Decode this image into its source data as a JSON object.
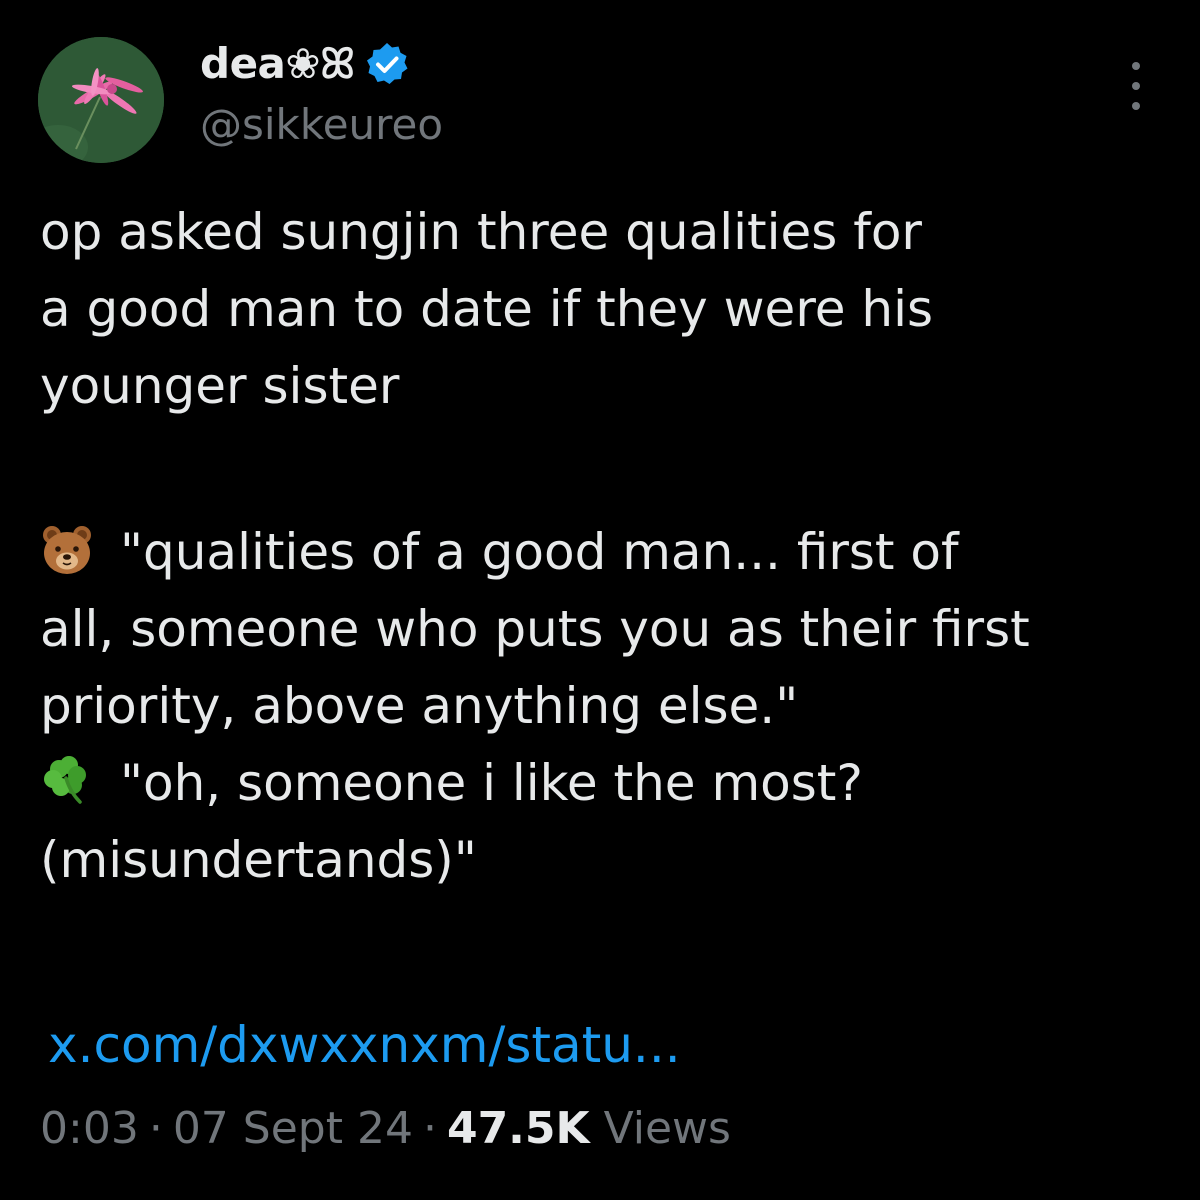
{
  "author": {
    "display_name": "dea❀ꕤ",
    "handle": "@sikkeureo",
    "verified": true,
    "avatar_icon": "pink-flower-avatar"
  },
  "menu": {
    "icon": "more-options-icon"
  },
  "tweet": {
    "lines_part1": [
      "op asked sungjin three qualities for",
      "a good man to date if they were his",
      "younger sister"
    ],
    "quote1": {
      "icon": "bear-face-emoji-icon",
      "lines": [
        "\"qualities of a good man... first of",
        "all, someone who puts you as their first",
        "priority, above anything else.\""
      ]
    },
    "quote2": {
      "icon": "four-leaf-clover-emoji-icon",
      "lines": [
        "\"oh, someone i like the most?",
        "(misundertands)\""
      ]
    },
    "link": "x.com/dxwxxnxm/statu..."
  },
  "meta": {
    "time": "0:03",
    "date": "07 Sept 24",
    "views_count": "47.5K",
    "views_label": "Views",
    "separator": "·"
  },
  "colors": {
    "background": "#000000",
    "text": "#e7e9ea",
    "secondary": "#71767b",
    "link": "#1d9bf0",
    "verified": "#1d9bf0"
  }
}
